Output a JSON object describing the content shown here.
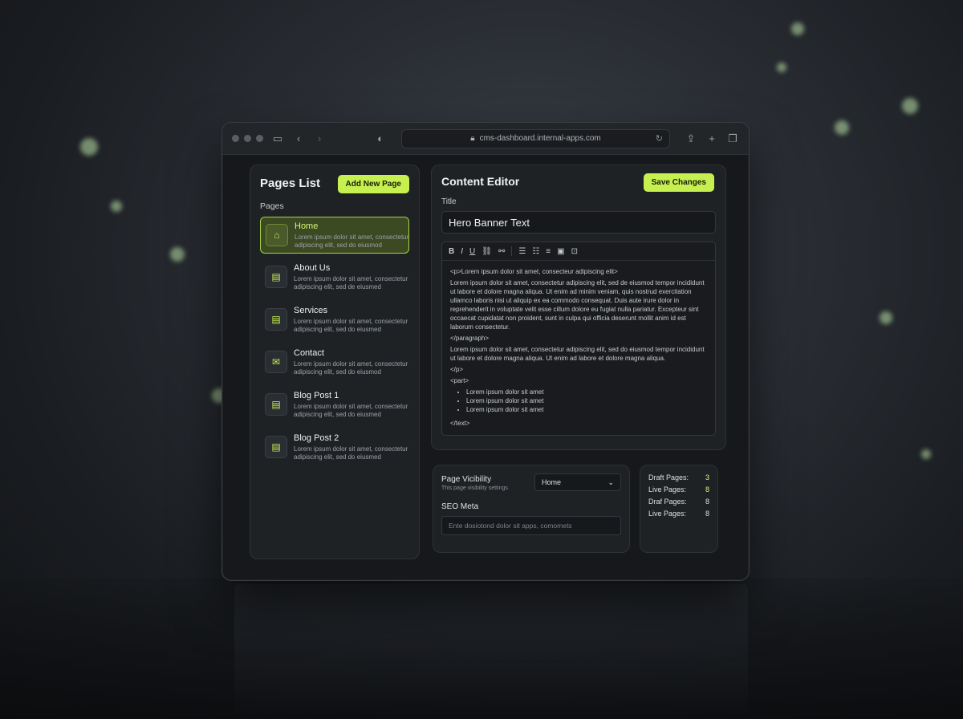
{
  "browser": {
    "url": "cms-dashboard.internal-apps.com"
  },
  "pages_list": {
    "title": "Pages List",
    "add_button": "Add New Page",
    "section_label": "Pages",
    "items": [
      {
        "title": "Home",
        "desc": "Lorem ipsum dolor sit amet, consectetur adipiscing elit, sed do eiusmod",
        "icon": "home-icon",
        "active": true
      },
      {
        "title": "About Us",
        "desc": "Lorem ipsum dolor sit amet, consectetur adipiscing elit, sed de eiusmed",
        "icon": "document-icon"
      },
      {
        "title": "Services",
        "desc": "Lorem ipsum dolor sit amet, consectetur adipiscing elit, sed do eiusmed",
        "icon": "document-icon"
      },
      {
        "title": "Contact",
        "desc": "Lorem ipsum dolor sit amet, consectetur adipiscing elit, sed do eiusmod",
        "icon": "mail-icon"
      },
      {
        "title": "Blog Post 1",
        "desc": "Lorem ipsum dolor sit amet, consectetur adipiscing elit, sed do eiusmed",
        "icon": "document-icon"
      },
      {
        "title": "Blog Post 2",
        "desc": "Lorem ipsum dolor sit amet, consectetur adipiscing elit, sed do eiusmed",
        "icon": "document-icon"
      }
    ]
  },
  "editor": {
    "title": "Content Editor",
    "save_button": "Save Changes",
    "title_label": "Title",
    "title_value": "Hero Banner Text",
    "body": {
      "line1": "<p>Lorem ipsum dolor sit amet, consecteur adipiscing elit>",
      "para1": "Lorem ipsum dolor sit amet, consectetur adipiscing elit, sed de eiusmod tempor incididunt ut labore et dolore magna aliqua. Ut enim ad minim veniam, quis nostrud exercitation ullamco laboris nisi ut aliquip ex ea commodo consequat. Duis aute irure dolor in reprehenderit in voluptate velit esse cillum dolore eu fugiat nulla pariatur. Excepteur sint occaecat cupidatat non proident, sunt in culpa qui officia deserunt mollit anim id est laborum consectetur.",
      "close_para": "</paragraph>",
      "para2": "Lorem ipsum dolor sit amet, consectetur adipiscing elit, sed do eiusmod tempor incididunt ut labore et dolore magna aliqua. Ut enim ad labore et dolore magna aliqua.",
      "tag1": "</p>",
      "tag2": "<part>",
      "bullets": [
        "Lorem ipsum dolor sit amet",
        "Lorem ipsum dolor sit amet",
        "Lorem ipsum dolor sit amet"
      ],
      "closing": "</text>"
    }
  },
  "visibility": {
    "title": "Page Vicibility",
    "subtitle": "This page visibility settings",
    "select_value": "Home",
    "seo_label": "SEO Meta",
    "seo_placeholder": "Ente dosiotond dolor sit apps, comomets"
  },
  "stats": [
    {
      "label": "Draft Pages:",
      "value": "3"
    },
    {
      "label": "Live Pages:",
      "value": "8"
    },
    {
      "label": "Draf Pages:",
      "value": "8"
    },
    {
      "label": "Live Pages:",
      "value": "8"
    }
  ],
  "colors": {
    "accent": "#c6f04f",
    "background": "#16181b",
    "panel": "#1f2225"
  }
}
